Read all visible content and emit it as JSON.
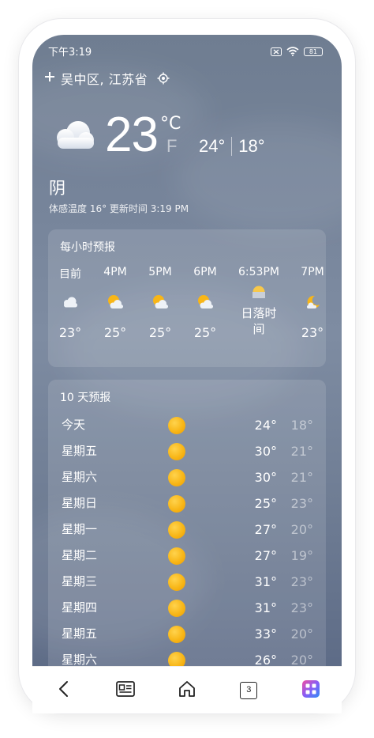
{
  "status_bar": {
    "time": "下午3:19",
    "battery": "81"
  },
  "location": {
    "add_icon": "plus-icon",
    "name": "吴中区, 江苏省",
    "locate_icon": "location-target-icon"
  },
  "current": {
    "icon": "cloudy-icon",
    "temperature": "23",
    "unit_c": "°C",
    "unit_f": "F",
    "high": "24°",
    "low": "18°",
    "condition": "阴",
    "feels_like_line": "体感温度 16° 更新时间 3:19 PM"
  },
  "hourly": {
    "title": "每小时预报",
    "items": [
      {
        "time": "目前",
        "icon": "cloudy-icon",
        "temp": "23°"
      },
      {
        "time": "4PM",
        "icon": "partly-cloudy-icon",
        "temp": "25°"
      },
      {
        "time": "5PM",
        "icon": "partly-cloudy-icon",
        "temp": "25°"
      },
      {
        "time": "6PM",
        "icon": "partly-cloudy-icon",
        "temp": "25°"
      },
      {
        "time": "6:53PM",
        "icon": "sunset-icon",
        "temp": "日落时间"
      },
      {
        "time": "7PM",
        "icon": "moon-cloud-icon",
        "temp": "23°"
      }
    ]
  },
  "daily": {
    "title": "10 天预报",
    "items": [
      {
        "day": "今天",
        "icon": "sun-icon",
        "high": "24°",
        "low": "18°"
      },
      {
        "day": "星期五",
        "icon": "sun-icon",
        "high": "30°",
        "low": "21°"
      },
      {
        "day": "星期六",
        "icon": "sun-icon",
        "high": "30°",
        "low": "21°"
      },
      {
        "day": "星期日",
        "icon": "sun-icon",
        "high": "25°",
        "low": "23°"
      },
      {
        "day": "星期一",
        "icon": "sun-icon",
        "high": "27°",
        "low": "20°"
      },
      {
        "day": "星期二",
        "icon": "sun-icon",
        "high": "27°",
        "low": "19°"
      },
      {
        "day": "星期三",
        "icon": "sun-icon",
        "high": "31°",
        "low": "23°"
      },
      {
        "day": "星期四",
        "icon": "sun-icon",
        "high": "31°",
        "low": "23°"
      },
      {
        "day": "星期五",
        "icon": "sun-icon",
        "high": "33°",
        "low": "20°"
      },
      {
        "day": "星期六",
        "icon": "sun-icon",
        "high": "26°",
        "low": "20°"
      }
    ]
  },
  "browser_nav": {
    "tab_count": "3",
    "icons": [
      "back-icon",
      "reader-icon",
      "home-icon",
      "tabs-icon",
      "apps-icon"
    ]
  },
  "colors": {
    "sky_top": "#6f7d91",
    "sky_bottom": "#5a6884",
    "sun": "#f8b617",
    "nav_accent": "#4f7df5"
  }
}
